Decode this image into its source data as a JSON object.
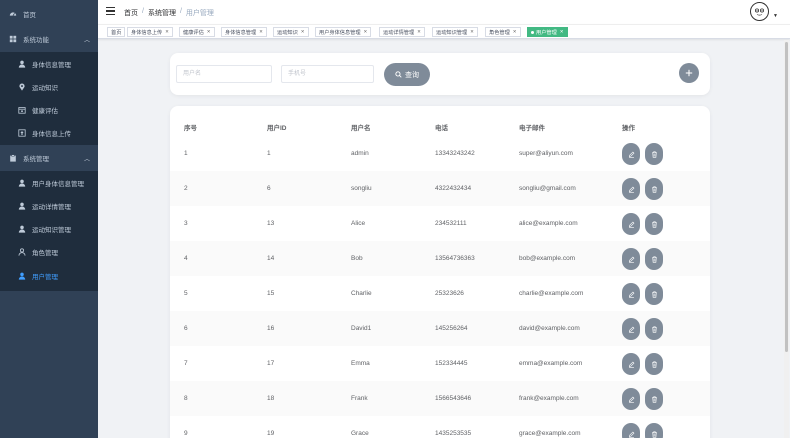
{
  "sidebar": {
    "items": [
      {
        "label": "首页",
        "icon": "dashboard-icon",
        "level": 0
      },
      {
        "label": "系统功能",
        "icon": "grid-icon",
        "level": 0,
        "expandable": true
      },
      {
        "label": "身体信息管理",
        "icon": "user-icon",
        "level": 1
      },
      {
        "label": "运动知识",
        "icon": "location-icon",
        "level": 1
      },
      {
        "label": "健康评估",
        "icon": "calendar-icon",
        "level": 1
      },
      {
        "label": "身体信息上传",
        "icon": "upload-icon",
        "level": 1
      },
      {
        "label": "系统管理",
        "icon": "clipboard-icon",
        "level": 0,
        "expandable": true
      },
      {
        "label": "用户身体信息管理",
        "icon": "user-icon",
        "level": 1
      },
      {
        "label": "运动详情管理",
        "icon": "user-icon",
        "level": 1
      },
      {
        "label": "运动知识管理",
        "icon": "user-icon",
        "level": 1
      },
      {
        "label": "角色管理",
        "icon": "person-outline-icon",
        "level": 1
      },
      {
        "label": "用户管理",
        "icon": "user-icon",
        "level": 1,
        "active": true
      }
    ]
  },
  "header": {
    "breadcrumb": [
      "首页",
      "系统管理",
      "用户管理"
    ]
  },
  "tags": [
    {
      "label": "首页",
      "closable": false
    },
    {
      "label": "身体信息上传",
      "closable": true
    },
    {
      "label": "健康评估",
      "closable": true
    },
    {
      "label": "身体信息管理",
      "closable": true
    },
    {
      "label": "运动知识",
      "closable": true
    },
    {
      "label": "用户身体信息管理",
      "closable": true
    },
    {
      "label": "运动详情管理",
      "closable": true
    },
    {
      "label": "运动知识管理",
      "closable": true
    },
    {
      "label": "角色管理",
      "closable": true
    },
    {
      "label": "用户管理",
      "closable": true,
      "active": true
    }
  ],
  "search": {
    "username_placeholder": "用户名",
    "phone_placeholder": "手机号",
    "search_label": "查询"
  },
  "table": {
    "columns": [
      "序号",
      "用户ID",
      "用户名",
      "电话",
      "电子邮件",
      "操作"
    ],
    "rows": [
      [
        "1",
        "1",
        "admin",
        "13343243242",
        "super@aliyun.com"
      ],
      [
        "2",
        "6",
        "songliu",
        "4322432434",
        "songliu@gmail.com"
      ],
      [
        "3",
        "13",
        "Alice",
        "234532111",
        "alice@example.com"
      ],
      [
        "4",
        "14",
        "Bob",
        "13564736363",
        "bob@example.com"
      ],
      [
        "5",
        "15",
        "Charlie",
        "25323626",
        "charlie@example.com"
      ],
      [
        "6",
        "16",
        "David1",
        "145256264",
        "david@example.com"
      ],
      [
        "7",
        "17",
        "Emma",
        "152334445",
        "emma@example.com"
      ],
      [
        "8",
        "18",
        "Frank",
        "1566543646",
        "frank@example.com"
      ],
      [
        "9",
        "19",
        "Grace",
        "1435253535",
        "grace@example.com"
      ]
    ]
  },
  "colors": {
    "sidebar_bg": "#304156",
    "sidebar_sub_bg": "#1f2d3d",
    "sidebar_text": "#bfcbd9",
    "active_menu": "#409eff",
    "active_tag": "#42b983",
    "button_gray": "#7f8b99"
  }
}
